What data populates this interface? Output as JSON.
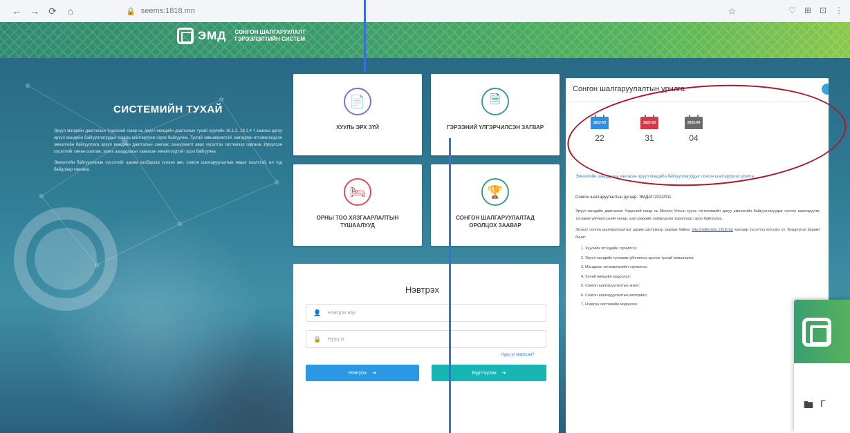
{
  "browser": {
    "address": "seems:1818.mn",
    "nav": [
      "←",
      "→",
      "⟳",
      "⌂"
    ],
    "lock": "🔒",
    "star": "☆",
    "tools": [
      "♡",
      "⊞",
      "⊡",
      "⋮"
    ]
  },
  "header": {
    "abbr": "ЭМД",
    "subtitle_line1": "СОНГОН ШАЛГАРУУЛАЛТ",
    "subtitle_line2": "ГЭРЭЭЛЭЛТИЙН СИСТЕМ"
  },
  "about": {
    "title": "СИСТЕМИЙН ТУХАЙ",
    "para1": "Эрүүл мэндийн даатгалын Үндэсний газар нь эрүүл мэндийн даатгалын тухай хуулийн 16.1.3, 18.1.4-т заасны дагуу эрүүл мэндийн байгууллагуудыг сонгон шалгаруулж гэрээ байгуулна. Тусгай зөвшөөрөлтэй, магадлан итгэмжлэгдсэн эмнэлгийн байгууллага эрүүл мэндийн даатгалын сангаас санхүүжилт авах хүсэлтээ системээр гаргана. Ирүүлсэн хүсэлтийг хянан шалгаж, зохих шаардлагыг хангасан эмнэлгүүдтэй гэрээ байгуулна.",
    "para2": "Эмнэлгийн байгууллагын хүсэлтийг цахим хэлбэрээр хүлээн авч, сонгон шалгаруулалтын явцыг нээлттэй, ил тод байдлаар хангана."
  },
  "tiles": [
    {
      "label": "ХУУЛЬ ЭРХ ЗҮЙ",
      "icon": "📄"
    },
    {
      "label": "ГЭРЭЭНИЙ ҮЛГЭРЧИЛСЭН ЗАГВАР",
      "icon": "🗎"
    },
    {
      "label": "ОРНЫ ТОО ХЯЗГААРЛАЛТЫН ТҮШААЛУУД",
      "icon": "🛏"
    },
    {
      "label": "СОНГОН ШАЛГАРУУЛАЛТАД ОРОЛЦОХ ЗААВАР",
      "icon": "🏆"
    }
  ],
  "login": {
    "title": "Нэвтрэх",
    "username_placeholder": "Нэвтрэх нэр",
    "password_placeholder": "Нууц үг",
    "forgot": "Нууц үг мартсан?",
    "login_button": "Нэвтрэх",
    "register_button": "Бүртгүүлэх",
    "user_icon": "👤",
    "lock_icon": "🔒",
    "arrow_icon": "➔"
  },
  "panel": {
    "title": "Сонгон шалгаруулалтын урилга",
    "calendars": [
      {
        "label": "2022-03",
        "day": "22",
        "color": "#2f8ee0"
      },
      {
        "label": "2022-03",
        "day": "31",
        "color": "#d9364a"
      },
      {
        "label": "2022-04",
        "day": "04",
        "color": "#6b6b6b"
      }
    ],
    "link_text": "Эмнэлгийн шаардлага хангасан эрүүл мэндийн байгууллагуудыг сонгон шалгаруулах урилга",
    "meta": "Сонгон шалгаруулалтын дугаар: ЭМДАТ/2022/011",
    "body1": "Эрүүл мэндийн даатгалын Үндэсний газар нь Монгол Улсын хууль тогтоомжийн дагуу эмнэлгийн байгууллагуудыг сонгон шалгаруулж, тусламж үйлчилгээний чанар, хүртээмжийг сайжруулах зорилгоор гэрээ байгуулна.",
    "body2": "Энэхүү сонгон шалгаруулалтыг цахим системээр зарлаж байна.",
    "link_url": "http://sellection.1818.mn",
    "body3": "хаягаар хүсэлтээ илгээнэ үү. Бүрдүүлэх баримт бичиг:",
    "items": [
      "Хуулийн этгээдийн гэрчилгээ;",
      "Эрүүл мэндийн тусламж үйлчилгээ эрхлэх тусгай зөвшөөрөл;",
      "Магадлан итгэмжлэлийн гэрчилгээ;",
      "Хүний нөөцийн мэдээлэл;",
      "Сонгон шалгаруулалтын анкет;",
      "Сонгон шалгаруулалтын материал;",
      "Нэгдсэн системийн мэдээлэл."
    ]
  },
  "popup": {
    "icons": [
      "🖿",
      "Г"
    ]
  }
}
